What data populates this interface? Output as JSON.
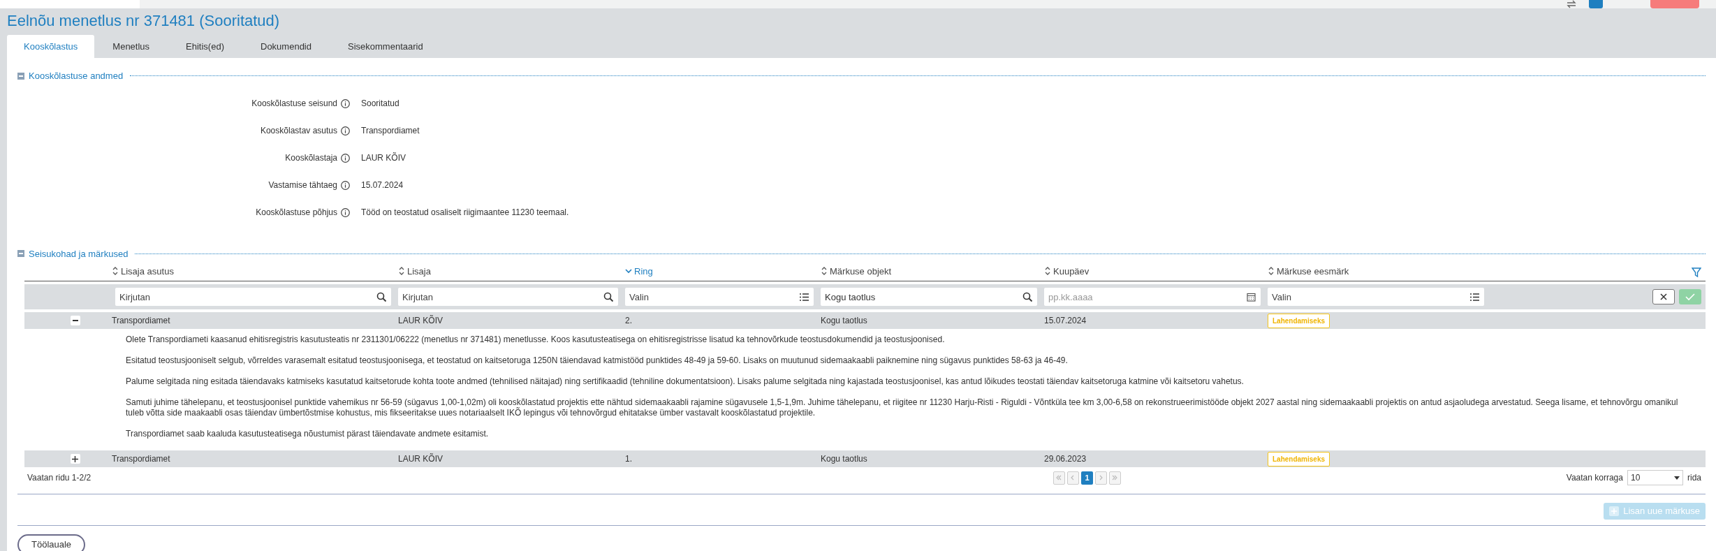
{
  "title": "Eelnõu menetlus nr 371481 (Sooritatud)",
  "tabs": [
    {
      "label": "Kooskõlastus",
      "selected": true
    },
    {
      "label": "Menetlus",
      "selected": false
    },
    {
      "label": "Ehitis(ed)",
      "selected": false
    },
    {
      "label": "Dokumendid",
      "selected": false
    },
    {
      "label": "Sisekommentaarid",
      "selected": false
    }
  ],
  "details": {
    "title": "Kooskõlastuse andmed",
    "expanded": true,
    "fields": [
      {
        "label": "Kooskõlastuse seisund",
        "value": "Sooritatud"
      },
      {
        "label": "Kooskõlastav asutus",
        "value": "Transpordiamet"
      },
      {
        "label": "Kooskõlastaja",
        "value": "LAUR KÕIV"
      },
      {
        "label": "Vastamise tähtaeg",
        "value": "15.07.2024"
      },
      {
        "label": "Kooskõlastuse põhjus",
        "value": "Tööd on teostatud osaliselt riigimaantee 11230 teemaal."
      }
    ]
  },
  "remarks": {
    "title": "Seisukohad ja märkused",
    "expanded": true,
    "columns": [
      {
        "label": "Lisaja asutus",
        "sorted": false
      },
      {
        "label": "Lisaja",
        "sorted": false
      },
      {
        "label": "Ring",
        "sorted": true
      },
      {
        "label": "Märkuse objekt",
        "sorted": false
      },
      {
        "label": "Kuupäev",
        "sorted": false
      },
      {
        "label": "Märkuse eesmärk",
        "sorted": false
      }
    ],
    "filters": [
      {
        "kind": "text",
        "placeholder": "Kirjutan"
      },
      {
        "kind": "text",
        "placeholder": "Kirjutan"
      },
      {
        "kind": "select",
        "placeholder": "Valin"
      },
      {
        "kind": "text",
        "value": "Kogu taotlus"
      },
      {
        "kind": "date",
        "placeholder": "pp.kk.aaaa"
      },
      {
        "kind": "select",
        "placeholder": "Valin"
      }
    ],
    "rows": [
      {
        "expanded": true,
        "cells": [
          "Transpordiamet",
          "LAUR KÕIV",
          "2.",
          "Kogu taotlus",
          "15.07.2024"
        ],
        "badge": "Lahendamiseks",
        "paragraphs": [
          "Olete Transpordiameti kaasanud ehitisregistris kasutusteatis nr 2311301/06222 (menetlus nr 371481) menetlusse. Koos kasutusteatisega on ehitisregistrisse lisatud ka tehnovõrkude teostusdokumendid ja teostusjoonised.",
          "Esitatud teostusjooniselt selgub, võrreldes varasemalt esitatud teostusjoonisega, et teostatud on kaitsetoruga 1250N täiendavad katmistööd punktides 48-49 ja 59-60. Lisaks on muutunud sidemaakaabli paiknemine ning sügavus punktides 58-63 ja 46-49.",
          "Palume selgitada ning esitada täiendavaks katmiseks kasutatud kaitsetorude kohta toote andmed (tehnilised näitajad) ning sertifikaadid (tehniline dokumentatsioon). Lisaks palume selgitada ning kajastada teostusjoonisel, kas antud lõikudes teostati täiendav kaitsetoruga katmine või kaitsetoru vahetus.",
          "Samuti juhime tähelepanu, et teostusjoonisel punktide vahemikus nr 56-59 (sügavus 1,00-1,02m) oli kooskõlastatud projektis ette nähtud sidemaakaabli rajamine sügavusele 1,5-1,9m. Juhime tähelepanu, et riigitee nr 11230 Harju-Risti - Riguldi - Võntküla tee km 3,00-6,58 on rekonstrueerimistööde objekt 2027 aastal ning sidemaakaabli projektis on antud asjaoludega arvestatud. Seega lisame, et tehnovõrgu omanikul tuleb võtta side maakaabli osas täiendav ümbertõstmise kohustus, mis fikseeritakse uues notariaalselt IKÕ lepingus või tehnovõrgud ehitatakse ümber vastavalt kooskõlastatud projektile.",
          "Transpordiamet saab kaaluda kasutusteatisega nõustumist pärast täiendavate andmete esitamist."
        ]
      },
      {
        "expanded": false,
        "cells": [
          "Transpordiamet",
          "LAUR KÕIV",
          "1.",
          "Kogu taotlus",
          "29.06.2023"
        ],
        "badge": "Lahendamiseks",
        "paragraphs": []
      }
    ],
    "summary": "Vaatan ridu 1-2/2",
    "pages": [
      {
        "label": "1",
        "selected": true
      }
    ],
    "page_size_label": "Vaatan korraga",
    "page_size": "10",
    "page_size_suffix": "rida",
    "add_button": {
      "label": "Lisan uue märkuse",
      "disabled": true
    }
  },
  "back_button": "Töölauale"
}
